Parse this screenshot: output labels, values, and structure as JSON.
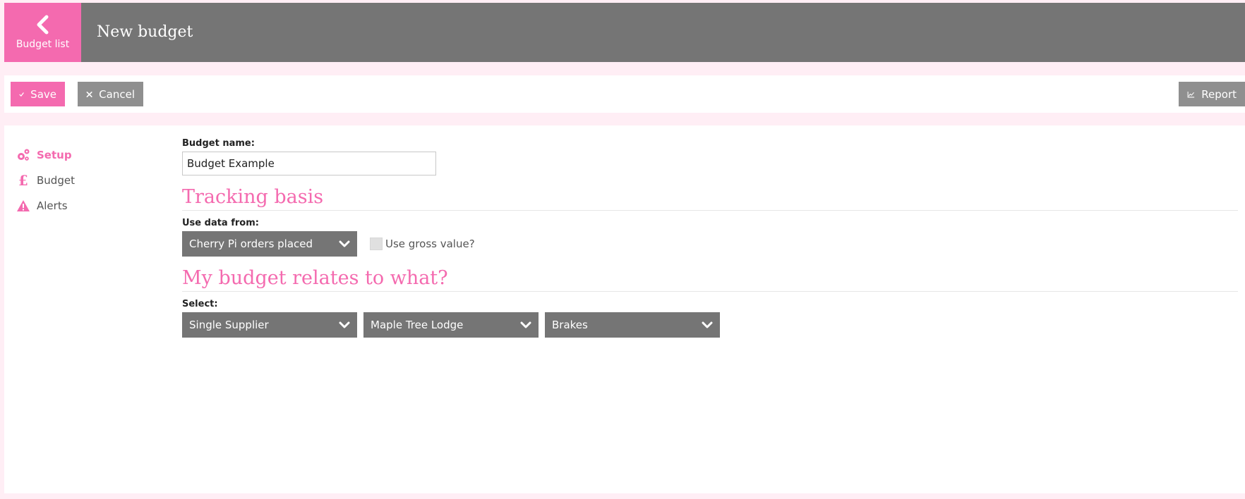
{
  "header": {
    "back_label": "Budget list",
    "title": "New budget"
  },
  "toolbar": {
    "save_label": "Save",
    "cancel_label": "Cancel",
    "report_label": "Report"
  },
  "sidebar": {
    "items": [
      {
        "label": "Setup",
        "icon": "gears-icon",
        "active": true
      },
      {
        "label": "Budget",
        "icon": "pound-icon",
        "active": false
      },
      {
        "label": "Alerts",
        "icon": "warning-icon",
        "active": false
      }
    ]
  },
  "form": {
    "budget_name_label": "Budget name:",
    "budget_name_value": "Budget Example",
    "tracking_heading": "Tracking basis",
    "use_data_label": "Use data from:",
    "use_data_value": "Cherry Pi orders placed",
    "gross_label": "Use gross value?",
    "gross_checked": false,
    "relates_heading": "My budget relates to what?",
    "select_label": "Select:",
    "selects": [
      "Single Supplier",
      "Maple Tree Lodge",
      "Brakes"
    ]
  },
  "colors": {
    "accent": "#f46aaf",
    "header_bg": "#757575",
    "button_grey": "#8f8f8f",
    "page_bg": "#ffeef5"
  }
}
